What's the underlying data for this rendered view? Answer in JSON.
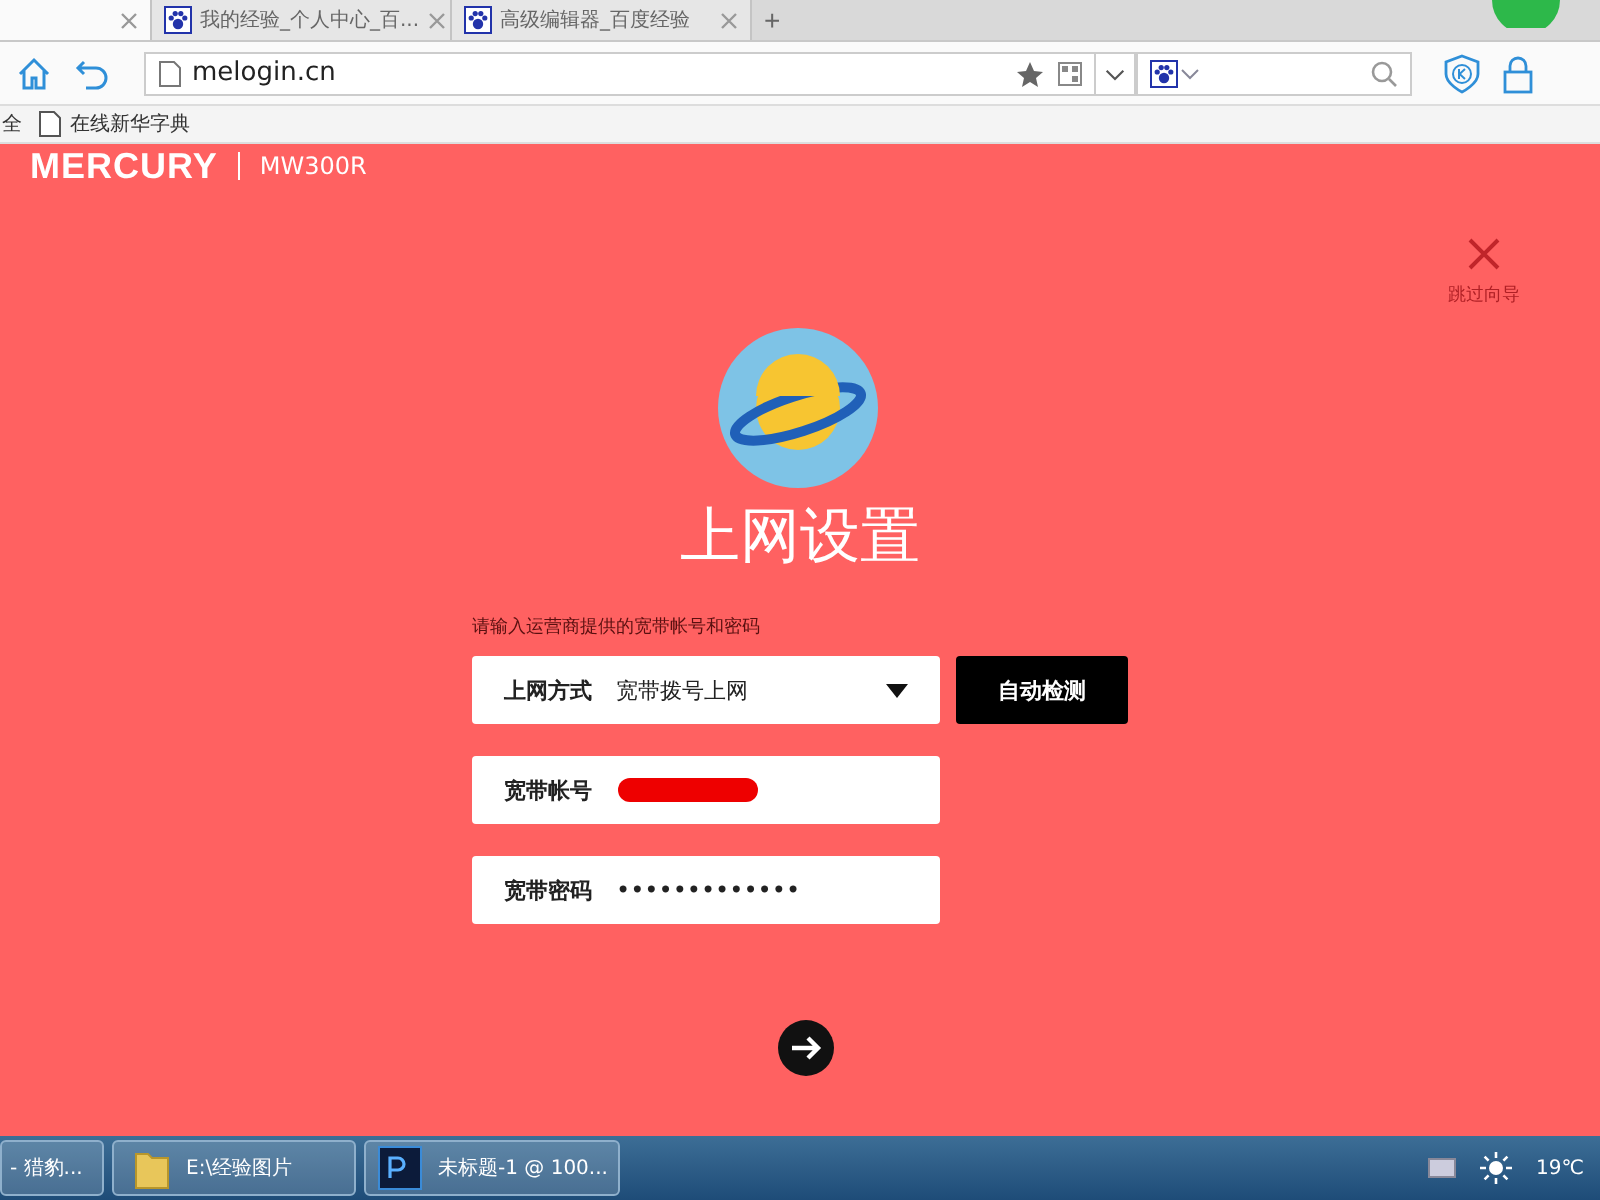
{
  "browser": {
    "tabs": [
      {
        "selected": true
      },
      {
        "label": "我的经验_个人中心_百...",
        "selected": false
      },
      {
        "label": "高级编辑器_百度经验",
        "selected": false
      }
    ],
    "new_tab": "+",
    "address": "melogin.cn",
    "bookmarks": [
      {
        "label": "全",
        "kind": "cut"
      },
      {
        "label": "在线新华字典",
        "kind": "page"
      }
    ]
  },
  "router": {
    "brand": "MERCURY",
    "model": "MW300R",
    "skip_label": "跳过向导",
    "title": "上网设置",
    "hint": "请输入运营商提供的宽带帐号和密码",
    "fields": [
      {
        "kind": "select",
        "label": "上网方式",
        "value": "宽带拨号上网"
      },
      {
        "kind": "redacted",
        "label": "宽带帐号"
      },
      {
        "kind": "password",
        "label": "宽带密码",
        "value": "•••••••••••••"
      }
    ],
    "detect_button": "自动检测"
  },
  "taskbar": {
    "items": [
      {
        "label": "- 猎豹...",
        "kind": "plain"
      },
      {
        "label": "E:\\经验图片",
        "kind": "folder"
      },
      {
        "label": "未标题-1 @ 100...",
        "kind": "ps"
      }
    ],
    "temperature": "19℃"
  }
}
